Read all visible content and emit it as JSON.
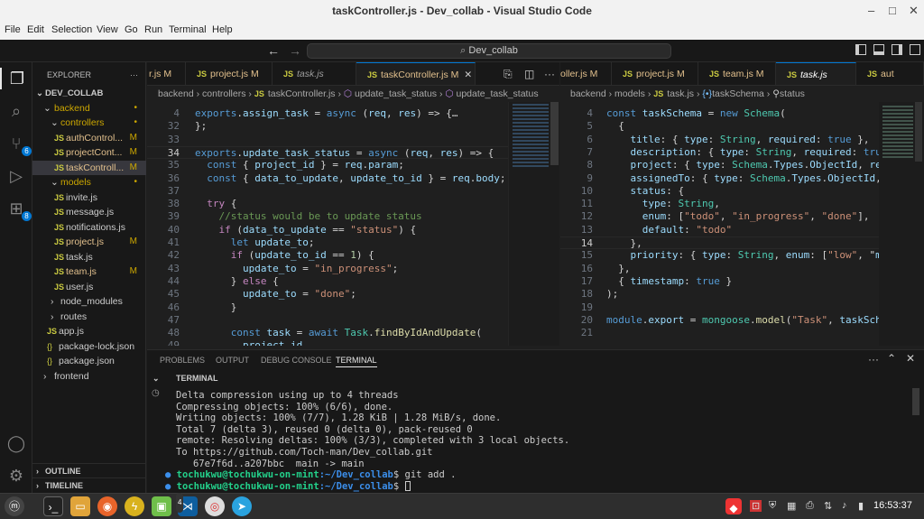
{
  "window": {
    "title": "taskController.js - Dev_collab - Visual Studio Code",
    "minimize": "–",
    "maximize": "□",
    "close": "✕"
  },
  "menu": [
    "File",
    "Edit",
    "Selection",
    "View",
    "Go",
    "Run",
    "Terminal",
    "Help"
  ],
  "search": {
    "text": "Dev_collab"
  },
  "activity": {
    "scm_badge": "6",
    "ext_badge": "8"
  },
  "explorer": {
    "header": "EXPLORER",
    "root": "DEV_COLLAB",
    "items": [
      {
        "label": "backend",
        "status": "•"
      },
      {
        "label": "controllers",
        "status": "•"
      },
      {
        "label": "authControl...",
        "status": "M"
      },
      {
        "label": "projectCont...",
        "status": "M"
      },
      {
        "label": "taskControll...",
        "status": "M"
      },
      {
        "label": "models",
        "status": "•"
      },
      {
        "label": "invite.js",
        "status": ""
      },
      {
        "label": "message.js",
        "status": ""
      },
      {
        "label": "notifications.js",
        "status": ""
      },
      {
        "label": "project.js",
        "status": "M"
      },
      {
        "label": "task.js",
        "status": ""
      },
      {
        "label": "team.js",
        "status": "M"
      },
      {
        "label": "user.js",
        "status": ""
      },
      {
        "label": "node_modules",
        "status": ""
      },
      {
        "label": "routes",
        "status": ""
      },
      {
        "label": "app.js",
        "status": ""
      },
      {
        "label": "package-lock.json",
        "status": ""
      },
      {
        "label": "package.json",
        "status": ""
      },
      {
        "label": "frontend",
        "status": ""
      }
    ],
    "outline": "OUTLINE",
    "timeline": "TIMELINE"
  },
  "left_tabs": [
    {
      "label": "r.js M"
    },
    {
      "label": "project.js M"
    },
    {
      "label": "task.js"
    },
    {
      "label": "taskController.js M"
    }
  ],
  "right_tabs": [
    {
      "label": "oller.js M"
    },
    {
      "label": "project.js M"
    },
    {
      "label": "team.js M"
    },
    {
      "label": "task.js"
    },
    {
      "label": "aut"
    }
  ],
  "left_breadcrumb": [
    "backend",
    "controllers",
    "taskController.js",
    "update_task_status",
    "update_task_status"
  ],
  "right_breadcrumb": [
    "backend",
    "models",
    "task.js",
    "taskSchema",
    "status"
  ],
  "left_code": [
    {
      "n": "4",
      "t": "exports.assign_task = async (req, res) => {…"
    },
    {
      "n": "32",
      "t": "};"
    },
    {
      "n": "33",
      "t": ""
    },
    {
      "n": "34",
      "t": "exports.update_task_status = async (req, res) => {"
    },
    {
      "n": "35",
      "t": "  const { project_id } = req.param;"
    },
    {
      "n": "36",
      "t": "  const { data_to_update, update_to_id } = req.body;"
    },
    {
      "n": "37",
      "t": ""
    },
    {
      "n": "38",
      "t": "  try {"
    },
    {
      "n": "39",
      "t": "    //status would be to update status"
    },
    {
      "n": "40",
      "t": "    if (data_to_update == \"status\") {"
    },
    {
      "n": "41",
      "t": "      let update_to;"
    },
    {
      "n": "42",
      "t": "      if (update_to_id == 1) {"
    },
    {
      "n": "43",
      "t": "        update_to = \"in_progress\";"
    },
    {
      "n": "44",
      "t": "      } else {"
    },
    {
      "n": "45",
      "t": "        update_to = \"done\";"
    },
    {
      "n": "46",
      "t": "      }"
    },
    {
      "n": "47",
      "t": ""
    },
    {
      "n": "48",
      "t": "      const task = await Task.findByIdAndUpdate("
    },
    {
      "n": "49",
      "t": "        project_id,"
    }
  ],
  "right_code": [
    {
      "n": "4",
      "t": "const taskSchema = new Schema("
    },
    {
      "n": "5",
      "t": "  {"
    },
    {
      "n": "6",
      "t": "    title: { type: String, required: true },"
    },
    {
      "n": "7",
      "t": "    description: { type: String, required: true"
    },
    {
      "n": "8",
      "t": "    project: { type: Schema.Types.ObjectId, ref"
    },
    {
      "n": "9",
      "t": "    assignedTo: { type: Schema.Types.ObjectId, "
    },
    {
      "n": "10",
      "t": "    status: {"
    },
    {
      "n": "11",
      "t": "      type: String,"
    },
    {
      "n": "12",
      "t": "      enum: [\"todo\", \"in_progress\", \"done\"],"
    },
    {
      "n": "13",
      "t": "      default: \"todo\""
    },
    {
      "n": "14",
      "t": "    },"
    },
    {
      "n": "15",
      "t": "    priority: { type: String, enum: [\"low\", \"med"
    },
    {
      "n": "16",
      "t": "  },"
    },
    {
      "n": "17",
      "t": "  { timestamp: true }"
    },
    {
      "n": "18",
      "t": ");"
    },
    {
      "n": "19",
      "t": ""
    },
    {
      "n": "20",
      "t": "module.export = mongoose.model(\"Task\", taskSche"
    },
    {
      "n": "21",
      "t": ""
    }
  ],
  "panel": {
    "tabs": [
      "PROBLEMS",
      "OUTPUT",
      "DEBUG CONSOLE",
      "TERMINAL"
    ],
    "section": "TERMINAL",
    "lines": [
      "Delta compression using up to 4 threads",
      "Compressing objects: 100% (6/6), done.",
      "Writing objects: 100% (7/7), 1.28 KiB | 1.28 MiB/s, done.",
      "Total 7 (delta 3), reused 0 (delta 0), pack-reused 0",
      "remote: Resolving deltas: 100% (3/3), completed with 3 local objects.",
      "To https://github.com/Toch-man/Dev_collab.git",
      "   67e7f6d..a207bbc  main -> main"
    ],
    "prompt_user": "tochukwu@tochukwu-on-mint",
    "prompt_path": ":~/Dev_collab",
    "prompt_sym": "$",
    "cmd1": " git add .",
    "cmd2": " "
  },
  "taskbar": {
    "clock": "16:53:37",
    "vscode_badge": "4"
  }
}
